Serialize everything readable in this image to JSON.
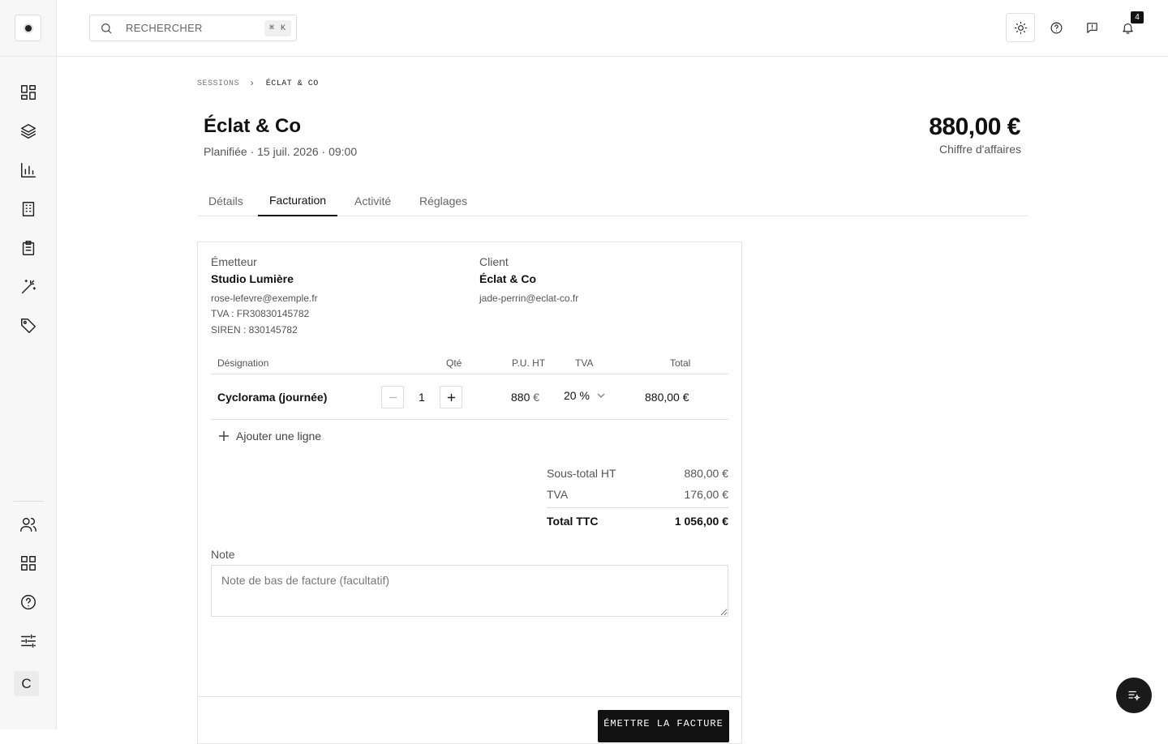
{
  "search": {
    "placeholder": "RECHERCHER",
    "shortcut": "⌘ K"
  },
  "notifications": {
    "count": "4"
  },
  "user": {
    "initial": "C"
  },
  "breadcrumb": {
    "parent": "SESSIONS",
    "current": "ÉCLAT & CO"
  },
  "header": {
    "title": "Éclat & Co",
    "subtitle": "Planifiée · 15 juil. 2026 · 09:00",
    "amount": "880,00 €",
    "amount_label": "Chiffre d'affaires"
  },
  "tabs": [
    {
      "label": "Détails"
    },
    {
      "label": "Facturation"
    },
    {
      "label": "Activité"
    },
    {
      "label": "Réglages"
    }
  ],
  "active_tab": "Facturation",
  "invoice": {
    "issuer": {
      "label": "Émetteur",
      "name": "Studio Lumière",
      "email": "rose-lefevre@exemple.fr",
      "vat": "TVA : FR30830145782",
      "siren": "SIREN : 830145782"
    },
    "client": {
      "label": "Client",
      "name": "Éclat & Co",
      "email": "jade-perrin@eclat-co.fr"
    },
    "columns": [
      "Désignation",
      "Qté",
      "P.U. HT",
      "TVA",
      "Total"
    ],
    "lines": [
      {
        "designation": "Cyclorama (journée)",
        "qty": "1",
        "unit_price": "880",
        "currency": "€",
        "vat": "20 %",
        "total": "880,00 €"
      }
    ],
    "add_line_label": "Ajouter une ligne",
    "totals": {
      "subtotal_label": "Sous-total HT",
      "subtotal_value": "880,00 €",
      "vat_label": "TVA",
      "vat_value": "176,00 €",
      "total_label": "Total TTC",
      "total_value": "1 056,00 €"
    },
    "note_label": "Note",
    "note_placeholder": "Note de bas de facture (facultatif)",
    "issue_button": "ÉMETTRE LA FACTURE"
  },
  "colors": {
    "accent": "#111111",
    "border": "#e4e4e4",
    "sidebar_bg": "#f7f7f7"
  }
}
